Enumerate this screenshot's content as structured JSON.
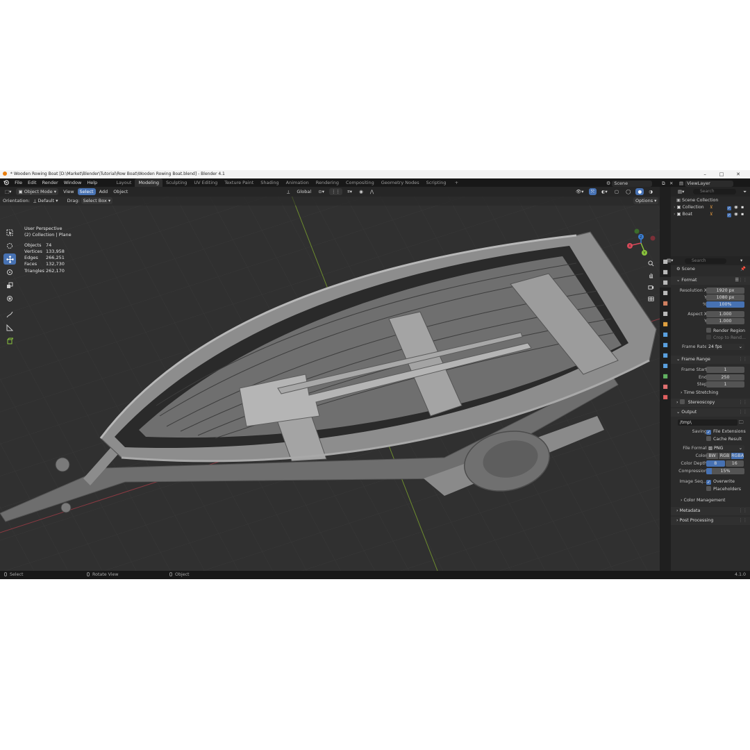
{
  "window": {
    "title": "* Wooden Rowing Boat [D:\\Market\\Blender\\Tutorial\\Row Boat\\Wooden Rowing Boat.blend] - Blender 4.1",
    "controls": {
      "minimize": "–",
      "maximize": "□",
      "close": "✕"
    }
  },
  "topbar": {
    "menus": [
      "File",
      "Edit",
      "Render",
      "Window",
      "Help"
    ],
    "workspaces": [
      "Layout",
      "Modeling",
      "Sculpting",
      "UV Editing",
      "Texture Paint",
      "Shading",
      "Animation",
      "Rendering",
      "Compositing",
      "Geometry Nodes",
      "Scripting"
    ],
    "active_workspace": "Modeling",
    "add_tab": "+",
    "scene_label": "Scene",
    "viewlayer_label": "ViewLayer"
  },
  "viewport_header": {
    "mode": "Object Mode",
    "menus": [
      "View",
      "Select",
      "Add",
      "Object"
    ],
    "selected_menu": "Select",
    "transform_orientation": "Global",
    "orientation_label": "Orientation:",
    "orientation_value": "Default",
    "drag_label": "Drag:",
    "drag_value": "Select Box",
    "options_label": "Options"
  },
  "viewport": {
    "view_name": "User Perspective",
    "collection_info": "(2) Collection | Plane",
    "stats": [
      {
        "label": "Objects",
        "value": "74"
      },
      {
        "label": "Vertices",
        "value": "133,958"
      },
      {
        "label": "Edges",
        "value": "266,251"
      },
      {
        "label": "Faces",
        "value": "132,730"
      },
      {
        "label": "Triangles",
        "value": "262,170"
      }
    ],
    "gizmo_axes": {
      "x": "X",
      "y": "Y",
      "z": "Z"
    }
  },
  "outliner": {
    "search_placeholder": "Search",
    "root": "Scene Collection",
    "items": [
      {
        "label": "Collection"
      },
      {
        "label": "Boat"
      }
    ]
  },
  "properties": {
    "search_placeholder": "Search",
    "context": "Scene",
    "format": {
      "title": "Format",
      "resolution_x_label": "Resolution X",
      "resolution_x": "1920 px",
      "resolution_y_label": "Y",
      "resolution_y": "1080 px",
      "percent_label": "%",
      "percent": "100%",
      "aspect_x_label": "Aspect X",
      "aspect_x": "1.000",
      "aspect_y_label": "Y",
      "aspect_y": "1.000",
      "render_region": "Render Region",
      "crop_to_render": "Crop to Rend...",
      "frame_rate_label": "Frame Rate",
      "frame_rate": "24 fps"
    },
    "frame_range": {
      "title": "Frame Range",
      "start_label": "Frame Start",
      "start": "1",
      "end_label": "End",
      "end": "250",
      "step_label": "Step",
      "step": "1"
    },
    "time_stretching": "Time Stretching",
    "stereoscopy": "Stereoscopy",
    "output": {
      "title": "Output",
      "path": "/tmp\\",
      "saving_label": "Saving",
      "file_extensions": "File Extensions",
      "cache_result": "Cache Result",
      "file_format_label": "File Format",
      "file_format": "PNG",
      "color_label": "Color",
      "color_options": [
        "BW",
        "RGB",
        "RGBA"
      ],
      "color_selected": "RGBA",
      "color_depth_label": "Color Depth",
      "color_depth_options": [
        "8",
        "16"
      ],
      "color_depth_selected": "8",
      "compression_label": "Compression",
      "compression": "15%",
      "compression_fraction": 0.15,
      "image_seq_label": "Image Seq...",
      "overwrite": "Overwrite",
      "placeholders": "Placeholders"
    },
    "color_management": "Color Management",
    "metadata": "Metadata",
    "post_processing": "Post Processing"
  },
  "statusbar": {
    "select": "Select",
    "rotate_view": "Rotate View",
    "object": "Object",
    "version": "4.1.0"
  },
  "colors": {
    "accent": "#4772b3",
    "axis_x": "#d94a5a",
    "axis_y": "#8ac43d",
    "axis_z": "#3a7fd5",
    "viewport_bg": "#303030"
  }
}
